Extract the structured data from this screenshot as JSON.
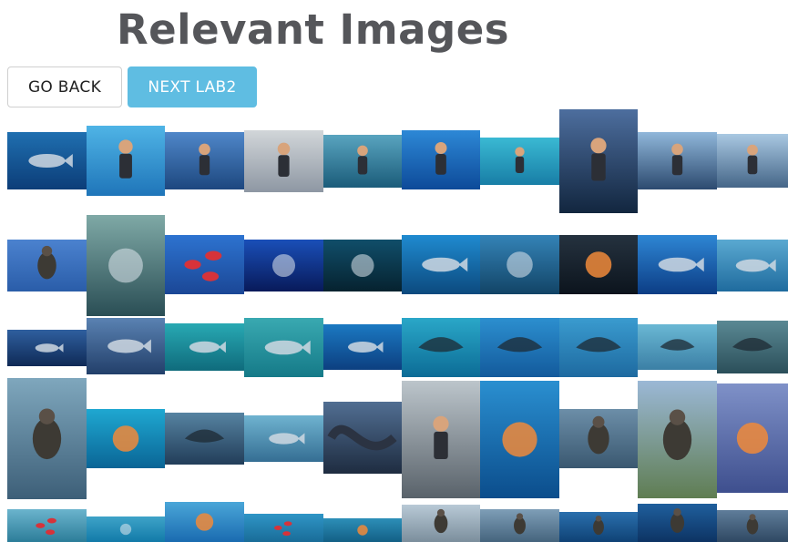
{
  "page": {
    "title": "Relevant Images"
  },
  "buttons": {
    "back_label": "GO BACK",
    "next_label": "NEXT LAB2"
  },
  "thumbnails": [
    {
      "subject": "dolphins-underwater",
      "bg": [
        "#1f6fb0",
        "#0c3d78"
      ]
    },
    {
      "subject": "diver-orange-fins",
      "bg": [
        "#4fb4e6",
        "#1f75b9"
      ]
    },
    {
      "subject": "cliff-diver-sky",
      "bg": [
        "#4f87c9",
        "#1d477f"
      ]
    },
    {
      "subject": "diver-mid-air",
      "bg": [
        "#d2d6d9",
        "#8e97a3"
      ]
    },
    {
      "subject": "snorkeler-surface",
      "bg": [
        "#59a4bf",
        "#1b5c7a"
      ]
    },
    {
      "subject": "scuba-diver-blue",
      "bg": [
        "#2d88d6",
        "#0d4a99"
      ]
    },
    {
      "subject": "snorkelers-shallow",
      "bg": [
        "#3ab9d3",
        "#187ea6"
      ]
    },
    {
      "subject": "diver-injured-arm",
      "bg": [
        "#4d6e9e",
        "#12263f"
      ]
    },
    {
      "subject": "fisherman-boat",
      "bg": [
        "#90b7da",
        "#2c4a6f"
      ]
    },
    {
      "subject": "fisherman-big-fish",
      "bg": [
        "#a9c8e2",
        "#456688"
      ]
    },
    {
      "subject": "seabird-sky",
      "bg": [
        "#4b82cf",
        "#2a5da9"
      ]
    },
    {
      "subject": "waterfall-forest",
      "bg": [
        "#7fa9a6",
        "#2a4e55"
      ]
    },
    {
      "subject": "red-bacteria",
      "bg": [
        "#2d73d0",
        "#1b4796"
      ]
    },
    {
      "subject": "radiolarian",
      "bg": [
        "#1a4fb8",
        "#081a5a"
      ]
    },
    {
      "subject": "diatoms",
      "bg": [
        "#104e6a",
        "#06222f"
      ]
    },
    {
      "subject": "clownfish-seaweed",
      "bg": [
        "#1f8bd0",
        "#0c4a7e"
      ]
    },
    {
      "subject": "coral-reef",
      "bg": [
        "#3483b7",
        "#124466"
      ]
    },
    {
      "subject": "sea-anemone",
      "bg": [
        "#25323f",
        "#0c141d"
      ]
    },
    {
      "subject": "whale-shark-underwater",
      "bg": [
        "#2e86d4",
        "#0c3d85"
      ]
    },
    {
      "subject": "shark-blue-water",
      "bg": [
        "#5aa9d1",
        "#1f6b9e"
      ]
    },
    {
      "subject": "whale-shark-spots",
      "bg": [
        "#2f5f9f",
        "#0f2a56"
      ]
    },
    {
      "subject": "great-white-shark",
      "bg": [
        "#5a82b2",
        "#223f6a"
      ]
    },
    {
      "subject": "shark-seafloor",
      "bg": [
        "#28a9b3",
        "#0f6b7c"
      ]
    },
    {
      "subject": "hammerhead-shark",
      "bg": [
        "#39a9b1",
        "#157a88"
      ]
    },
    {
      "subject": "hammerheads-school",
      "bg": [
        "#1b79c2",
        "#0c3f80"
      ]
    },
    {
      "subject": "manta-deep",
      "bg": [
        "#2aa7c8",
        "#0c6c96"
      ]
    },
    {
      "subject": "manta-ray",
      "bg": [
        "#2c8fcf",
        "#135a9c"
      ]
    },
    {
      "subject": "rays-group",
      "bg": [
        "#3a9bcf",
        "#1e6aa0"
      ]
    },
    {
      "subject": "stingray-tan",
      "bg": [
        "#6ab8d4",
        "#3b7fa5"
      ]
    },
    {
      "subject": "stingray-brown",
      "bg": [
        "#5a8994",
        "#2b4f5a"
      ]
    },
    {
      "subject": "peregrine-falcon",
      "bg": [
        "#7fa7bd",
        "#3d5f78"
      ]
    },
    {
      "subject": "sea-turtle",
      "bg": [
        "#1fa8d1",
        "#0a6596"
      ]
    },
    {
      "subject": "stingray-collage",
      "bg": [
        "#5683a1",
        "#223d59"
      ]
    },
    {
      "subject": "shark-swimming",
      "bg": [
        "#6fb3d0",
        "#356e93"
      ]
    },
    {
      "subject": "coiled-snake",
      "bg": [
        "#516e92",
        "#1e2c40"
      ]
    },
    {
      "subject": "man-holding-python",
      "bg": [
        "#bcc5cb",
        "#59626a"
      ]
    },
    {
      "subject": "crab-on-rock",
      "bg": [
        "#2a8fd0",
        "#0b4d8c"
      ]
    },
    {
      "subject": "duck-on-water",
      "bg": [
        "#6c8ea8",
        "#3a5870"
      ]
    },
    {
      "subject": "greylag-goose",
      "bg": [
        "#9bb8d6",
        "#5f7d52"
      ]
    },
    {
      "subject": "jellyfish-purple",
      "bg": [
        "#7f91c8",
        "#3e4f8e"
      ]
    },
    {
      "subject": "red-coral-branch",
      "bg": [
        "#6bb4cd",
        "#2c7d99"
      ]
    },
    {
      "subject": "white-worm",
      "bg": [
        "#3ea3c8",
        "#127aa8"
      ]
    },
    {
      "subject": "octopus-blue",
      "bg": [
        "#4aa6d8",
        "#1a6bb0"
      ]
    },
    {
      "subject": "red-sea-star",
      "bg": [
        "#2f95c6",
        "#196c98"
      ]
    },
    {
      "subject": "orange-octopus",
      "bg": [
        "#2d8fb8",
        "#135f85"
      ]
    },
    {
      "subject": "storks",
      "bg": [
        "#b8c9d6",
        "#7b8e9c"
      ]
    },
    {
      "subject": "sandpiper-shore",
      "bg": [
        "#7e9eb7",
        "#45647d"
      ]
    },
    {
      "subject": "shorebird-water",
      "bg": [
        "#2a6fad",
        "#0f4275"
      ]
    },
    {
      "subject": "penguins-water",
      "bg": [
        "#1f5f9d",
        "#0d3363"
      ]
    },
    {
      "subject": "duck-dark-water",
      "bg": [
        "#5f7d9a",
        "#2f4862"
      ]
    }
  ]
}
